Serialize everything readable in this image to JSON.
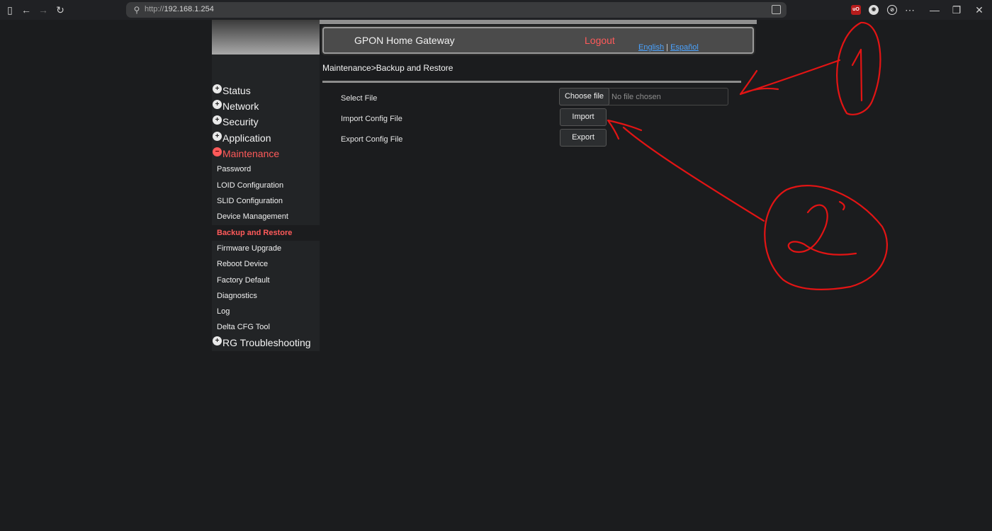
{
  "browser": {
    "url_scheme": "http://",
    "url_host": "192.168.1.254"
  },
  "header": {
    "title": "GPON Home Gateway",
    "logout": "Logout",
    "lang_english": "English",
    "lang_separator": "|",
    "lang_spanish": "Español"
  },
  "sidebar": {
    "top_items": [
      {
        "label": "Status"
      },
      {
        "label": "Network"
      },
      {
        "label": "Security"
      },
      {
        "label": "Application"
      },
      {
        "label": "Maintenance"
      },
      {
        "label": "RG Troubleshooting"
      }
    ],
    "sub_items": [
      {
        "label": "Password"
      },
      {
        "label": "LOID Configuration"
      },
      {
        "label": "SLID Configuration"
      },
      {
        "label": "Device Management"
      },
      {
        "label": "Backup and Restore"
      },
      {
        "label": "Firmware Upgrade"
      },
      {
        "label": "Reboot Device"
      },
      {
        "label": "Factory Default"
      },
      {
        "label": "Diagnostics"
      },
      {
        "label": "Log"
      },
      {
        "label": "Delta CFG Tool"
      }
    ]
  },
  "main": {
    "breadcrumb": "Maintenance>Backup and Restore",
    "select_file_label": "Select File",
    "choose_file_button": "Choose file",
    "no_file_text": "No file chosen",
    "import_label": "Import Config File",
    "import_button": "Import",
    "export_label": "Export Config File",
    "export_button": "Export"
  },
  "colors": {
    "accent_red": "#ff5a5a",
    "link_blue": "#4ba3ff",
    "annotation_red": "#e31414"
  },
  "annotations": [
    "arrow-1",
    "arrow-2"
  ]
}
